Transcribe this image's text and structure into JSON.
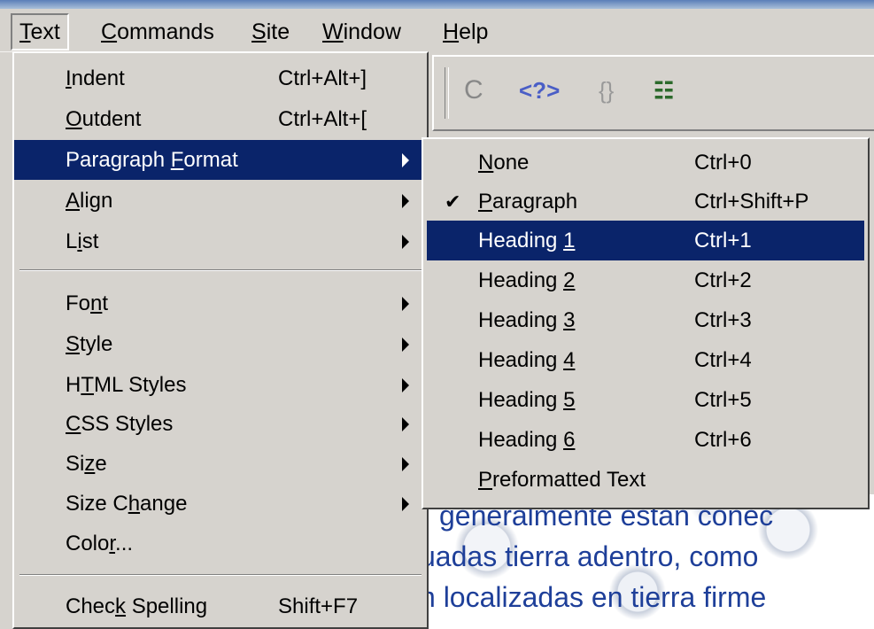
{
  "menubar": {
    "items": [
      {
        "name": "text",
        "pre": "",
        "key": "T",
        "post": "ext"
      },
      {
        "name": "commands",
        "pre": "",
        "key": "C",
        "post": "ommands"
      },
      {
        "name": "site",
        "pre": "",
        "key": "S",
        "post": "ite"
      },
      {
        "name": "window",
        "pre": "",
        "key": "W",
        "post": "indow"
      },
      {
        "name": "help",
        "pre": "",
        "key": "H",
        "post": "elp"
      }
    ]
  },
  "toolbar": {
    "icons": [
      "refresh-icon",
      "code-view-icon",
      "braces-icon",
      "list-options-icon"
    ],
    "glyphs": {
      "refresh": "C",
      "code": "<?>",
      "braces": "{}",
      "list": "☷"
    }
  },
  "text_menu": {
    "items": [
      {
        "pre": "",
        "key": "I",
        "post": "ndent",
        "shortcut": "Ctrl+Alt+]",
        "submenu": false
      },
      {
        "pre": "",
        "key": "O",
        "post": "utdent",
        "shortcut": "Ctrl+Alt+[",
        "submenu": false
      },
      {
        "pre": "Paragraph ",
        "key": "F",
        "post": "ormat",
        "shortcut": "",
        "submenu": true,
        "highlighted": true
      },
      {
        "pre": "",
        "key": "A",
        "post": "lign",
        "shortcut": "",
        "submenu": true
      },
      {
        "pre": "L",
        "key": "i",
        "post": "st",
        "shortcut": "",
        "submenu": true
      },
      {
        "pre": "Fo",
        "key": "n",
        "post": "t",
        "shortcut": "",
        "submenu": true
      },
      {
        "pre": "",
        "key": "S",
        "post": "tyle",
        "shortcut": "",
        "submenu": true
      },
      {
        "pre": "H",
        "key": "T",
        "post": "ML Styles",
        "shortcut": "",
        "submenu": true
      },
      {
        "pre": "",
        "key": "C",
        "post": "SS Styles",
        "shortcut": "",
        "submenu": true
      },
      {
        "pre": "Si",
        "key": "z",
        "post": "e",
        "shortcut": "",
        "submenu": true
      },
      {
        "pre": "Size C",
        "key": "h",
        "post": "ange",
        "shortcut": "",
        "submenu": true
      },
      {
        "pre": "Colo",
        "key": "r",
        "post": "...",
        "shortcut": "",
        "submenu": false
      },
      {
        "pre": "Chec",
        "key": "k",
        "post": " Spelling",
        "shortcut": "Shift+F7",
        "submenu": false
      }
    ]
  },
  "paragraph_format_menu": {
    "items": [
      {
        "pre": "",
        "key": "N",
        "post": "one",
        "shortcut": "Ctrl+0",
        "checked": false
      },
      {
        "pre": "",
        "key": "P",
        "post": "aragraph",
        "shortcut": "Ctrl+Shift+P",
        "checked": true
      },
      {
        "pre": "Heading ",
        "key": "1",
        "post": "",
        "shortcut": "Ctrl+1",
        "checked": false,
        "highlighted": true
      },
      {
        "pre": "Heading ",
        "key": "2",
        "post": "",
        "shortcut": "Ctrl+2",
        "checked": false
      },
      {
        "pre": "Heading ",
        "key": "3",
        "post": "",
        "shortcut": "Ctrl+3",
        "checked": false
      },
      {
        "pre": "Heading ",
        "key": "4",
        "post": "",
        "shortcut": "Ctrl+4",
        "checked": false
      },
      {
        "pre": "Heading ",
        "key": "5",
        "post": "",
        "shortcut": "Ctrl+5",
        "checked": false
      },
      {
        "pre": "Heading ",
        "key": "6",
        "post": "",
        "shortcut": "Ctrl+6",
        "checked": false
      },
      {
        "pre": "",
        "key": "P",
        "post": "reformatted Text",
        "shortcut": "",
        "checked": false
      }
    ]
  },
  "document": {
    "lines": [
      "generalmente están conec",
      "uadas tierra adentro, como",
      "n localizadas en tierra firme"
    ]
  },
  "colors": {
    "menu_bg": "#d6d3ce",
    "highlight": "#0a246a",
    "doc_text": "#1e3f99"
  }
}
